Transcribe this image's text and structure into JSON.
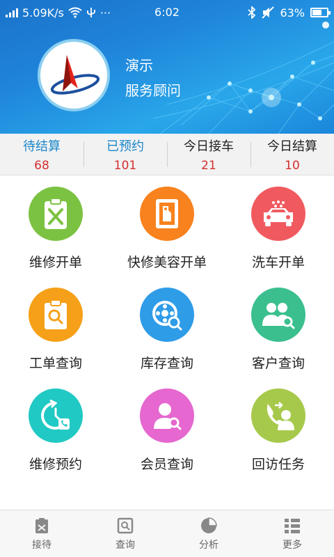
{
  "status_bar": {
    "network_speed": "5.09K/s",
    "time": "6:02",
    "battery": "63%",
    "battery_level": 0.63,
    "icons": [
      "signal-icon",
      "wifi-icon",
      "usb-icon",
      "more-icon",
      "bluetooth-icon",
      "mute-icon",
      "battery-icon"
    ]
  },
  "profile": {
    "name": "演示",
    "role": "服务顾问",
    "avatar_icon": "company-logo"
  },
  "stats": [
    {
      "label": "待结算",
      "value": "68",
      "label_color": "#1a86c9"
    },
    {
      "label": "已预约",
      "value": "101",
      "label_color": "#1a86c9"
    },
    {
      "label": "今日接车",
      "value": "21",
      "label_color": "#222222"
    },
    {
      "label": "今日结算",
      "value": "10",
      "label_color": "#222222"
    }
  ],
  "grid": [
    {
      "label": "维修开单",
      "color": "#7cc242",
      "icon": "repair-clipboard-icon"
    },
    {
      "label": "快修美容开单",
      "color": "#f7821e",
      "icon": "quick-repair-icon"
    },
    {
      "label": "洗车开单",
      "color": "#f05a5f",
      "icon": "car-wash-icon"
    },
    {
      "label": "工单查询",
      "color": "#f5a018",
      "icon": "order-search-icon"
    },
    {
      "label": "库存查询",
      "color": "#2f9ce8",
      "icon": "inventory-search-icon"
    },
    {
      "label": "客户查询",
      "color": "#3bbf8e",
      "icon": "customer-search-icon"
    },
    {
      "label": "维修预约",
      "color": "#20c9c4",
      "icon": "appointment-clock-icon"
    },
    {
      "label": "会员查询",
      "color": "#e567cf",
      "icon": "member-search-icon"
    },
    {
      "label": "回访任务",
      "color": "#a7c94b",
      "icon": "callback-task-icon"
    }
  ],
  "bottom_nav": [
    {
      "label": "接待",
      "icon": "reception-icon"
    },
    {
      "label": "查询",
      "icon": "query-icon"
    },
    {
      "label": "分析",
      "icon": "analysis-pie-icon"
    },
    {
      "label": "更多",
      "icon": "more-grid-icon"
    }
  ]
}
